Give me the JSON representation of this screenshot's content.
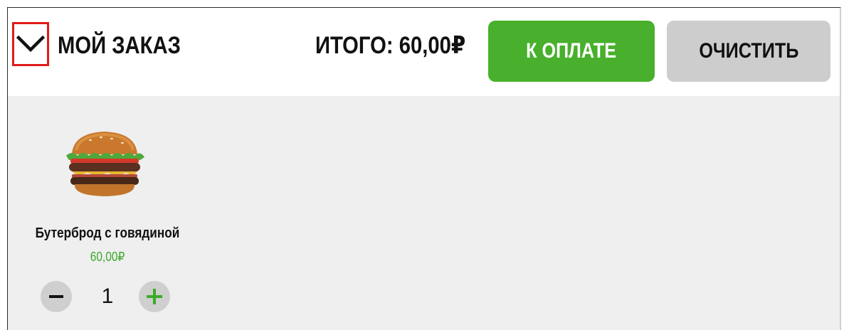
{
  "header": {
    "title": "МОЙ ЗАКАЗ",
    "total_label": "ИТОГО: 60,00₽",
    "pay_button": "К ОПЛАТЕ",
    "clear_button": "ОЧИСТИТЬ"
  },
  "colors": {
    "accent_green": "#48b02c",
    "price_green": "#3cab2a",
    "clear_gray": "#cdcdcd",
    "highlight_red": "#e11a1a"
  },
  "cart": {
    "items": [
      {
        "name": "Бутерброд с говядиной",
        "price": "60,00₽",
        "quantity": "1",
        "icon": "burger-image"
      }
    ]
  }
}
